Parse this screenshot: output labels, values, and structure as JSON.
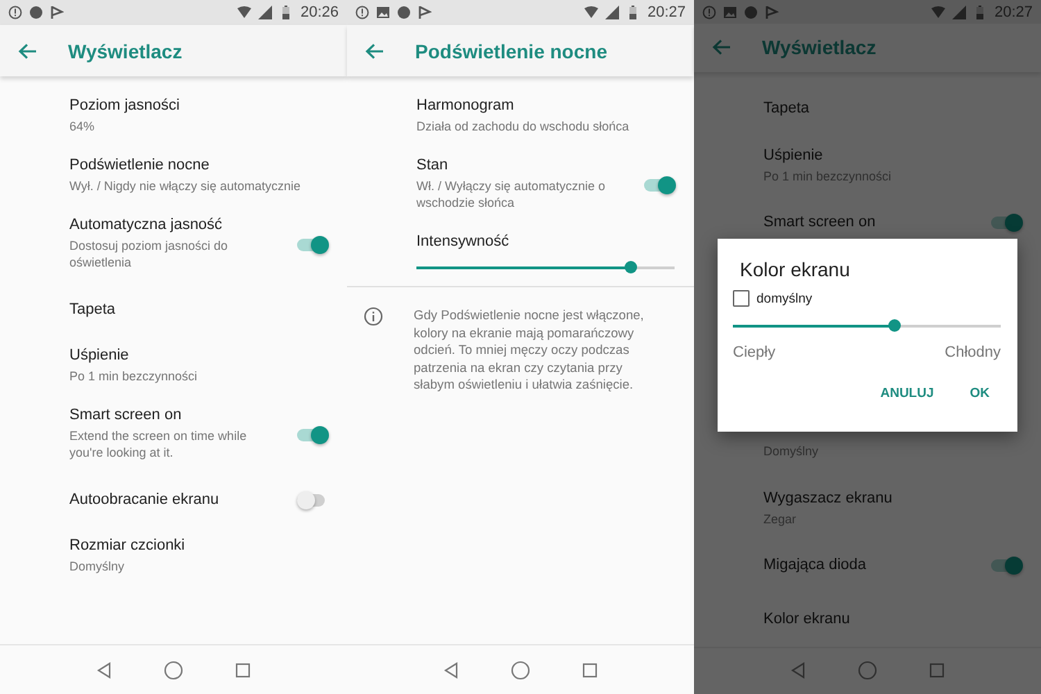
{
  "phones": [
    {
      "status_bar": {
        "time": "20:26"
      },
      "app_bar": {
        "title": "Wyświetlacz"
      },
      "dimmed": false,
      "items": [
        {
          "kind": "text",
          "title": "Poziom jasności",
          "subtitle": "64%"
        },
        {
          "kind": "text",
          "title": "Podświetlenie nocne",
          "subtitle": "Wył. / Nigdy nie włączy się automatycznie"
        },
        {
          "kind": "toggle",
          "title": "Automatyczna jasność",
          "subtitle": "Dostosuj poziom jasności do oświetlenia",
          "on": true
        },
        {
          "kind": "text",
          "title": "Tapeta"
        },
        {
          "kind": "text",
          "title": "Uśpienie",
          "subtitle": "Po 1 min bezczynności"
        },
        {
          "kind": "toggle",
          "title": "Smart screen on",
          "subtitle": "Extend the screen on time while you're looking at it.",
          "on": true
        },
        {
          "kind": "toggle",
          "title": "Autoobracanie ekranu",
          "on": false
        },
        {
          "kind": "text",
          "title": "Rozmiar czcionki",
          "subtitle": "Domyślny"
        }
      ]
    },
    {
      "status_bar": {
        "time": "20:27"
      },
      "app_bar": {
        "title": "Podświetlenie nocne"
      },
      "dimmed": false,
      "items": [
        {
          "kind": "text",
          "title": "Harmonogram",
          "subtitle": "Działa od zachodu do wschodu słońca"
        },
        {
          "kind": "toggle",
          "title": "Stan",
          "subtitle": "Wł. / Wyłączy się automatycznie o wschodzie słońca",
          "on": true
        },
        {
          "kind": "slider",
          "title": "Intensywność",
          "level": 0.83
        },
        {
          "kind": "info",
          "text": "Gdy Podświetlenie nocne jest włączone, kolory na ekranie mają pomarańczowy odcień. To mniej męczy oczy podczas patrzenia na ekran czy czytania przy słabym oświetleniu i ułatwia zaśnięcie."
        }
      ]
    },
    {
      "status_bar": {
        "time": "20:27"
      },
      "app_bar": {
        "title": "Wyświetlacz"
      },
      "dimmed": true,
      "items": [
        {
          "kind": "text",
          "title": "Tapeta"
        },
        {
          "kind": "text",
          "title": "Uśpienie",
          "subtitle": "Po 1 min bezczynności"
        },
        {
          "kind": "toggle",
          "title": "Smart screen on",
          "on": true
        },
        {
          "kind": "gap"
        },
        {
          "kind": "text",
          "subtitle": "Domyślny"
        },
        {
          "kind": "text",
          "title": "Wygaszacz ekranu",
          "subtitle": "Zegar"
        },
        {
          "kind": "toggle",
          "title": "Migająca dioda",
          "on": true
        },
        {
          "kind": "text",
          "title": "Kolor ekranu"
        }
      ],
      "dialog": {
        "title": "Kolor ekranu",
        "checkbox": {
          "label": "domyślny",
          "checked": false
        },
        "level": 0.6,
        "labels": [
          "Ciepły",
          "Chłodny"
        ],
        "buttons": [
          "ANULUJ",
          "OK"
        ]
      }
    }
  ]
}
